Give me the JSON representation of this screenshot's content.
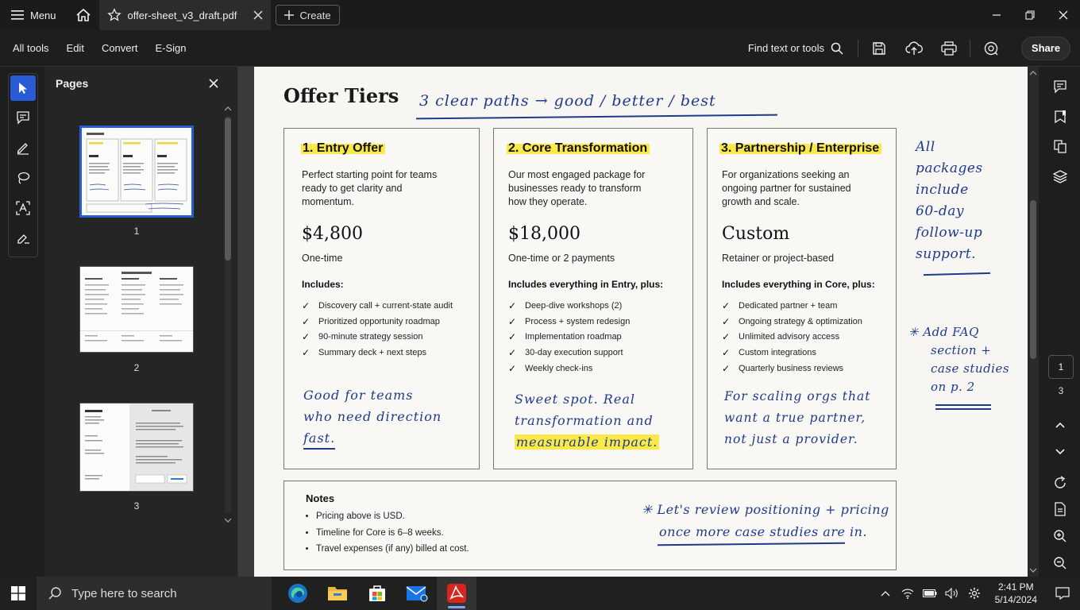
{
  "titlebar": {
    "menu_label": "Menu",
    "tab_title": "offer-sheet_v3_draft.pdf",
    "create_label": "Create"
  },
  "toolbar": {
    "items": [
      "All tools",
      "Edit",
      "Convert",
      "E-Sign"
    ],
    "find_label": "Find text or tools",
    "share_label": "Share"
  },
  "pages_panel": {
    "title": "Pages",
    "thumbnails": [
      {
        "number": "1",
        "selected": true
      },
      {
        "number": "2",
        "selected": false
      },
      {
        "number": "3",
        "selected": false
      }
    ]
  },
  "document": {
    "title": "Offer Tiers",
    "handwritten_title": "3 clear paths → good / better / best",
    "tiers": [
      {
        "name": "1. Entry Offer",
        "description": [
          "Perfect starting point for teams",
          "ready to get clarity and",
          "momentum."
        ],
        "price": "$4,800",
        "price_note": "One-time",
        "includes_title": "Includes:",
        "items": [
          "Discovery call + current-state audit",
          "Prioritized opportunity roadmap",
          "90-minute strategy session",
          "Summary deck + next steps"
        ],
        "note_lines": [
          "Good for teams",
          "who need direction",
          "fast."
        ]
      },
      {
        "name": "2. Core Transformation",
        "description": [
          "Our most engaged package for",
          "businesses ready to transform",
          "how they operate."
        ],
        "price": "$18,000",
        "price_note": "One-time or 2 payments",
        "includes_title": "Includes everything in Entry, plus:",
        "items": [
          "Deep-dive workshops (2)",
          "Process + system redesign",
          "Implementation roadmap",
          "30-day execution support",
          "Weekly check-ins"
        ],
        "note_lines": [
          "Sweet spot. Real",
          "transformation and",
          "measurable impact."
        ]
      },
      {
        "name": "3. Partnership / Enterprise",
        "description": [
          "For organizations seeking an",
          "ongoing partner for sustained",
          "growth and scale."
        ],
        "price": "Custom",
        "price_note": "Retainer or project-based",
        "includes_title": "Includes everything in Core, plus:",
        "items": [
          "Dedicated partner + team",
          "Ongoing strategy & optimization",
          "Unlimited advisory access",
          "Custom integrations",
          "Quarterly business reviews"
        ],
        "note_lines": [
          "For scaling orgs that",
          "want a true partner,",
          "not just a provider."
        ]
      }
    ],
    "side_note_1": [
      "All",
      "packages",
      "include",
      "60-day",
      "follow-up",
      "support."
    ],
    "side_note_2": [
      "✳ Add FAQ",
      "section +",
      "case studies",
      "on p. 2"
    ],
    "notes": {
      "title": "Notes",
      "items": [
        "Pricing above is USD.",
        "Timeline for Core is 6–8 weeks.",
        "Travel expenses (if any) billed at cost."
      ],
      "handwritten": [
        "✳ Let's review positioning + pricing",
        "once more case studies are in."
      ]
    }
  },
  "page_nav": {
    "current": "1",
    "total": "3"
  },
  "taskbar": {
    "search_placeholder": "Type here to search",
    "time": "2:41 PM",
    "date": "5/14/2024"
  }
}
